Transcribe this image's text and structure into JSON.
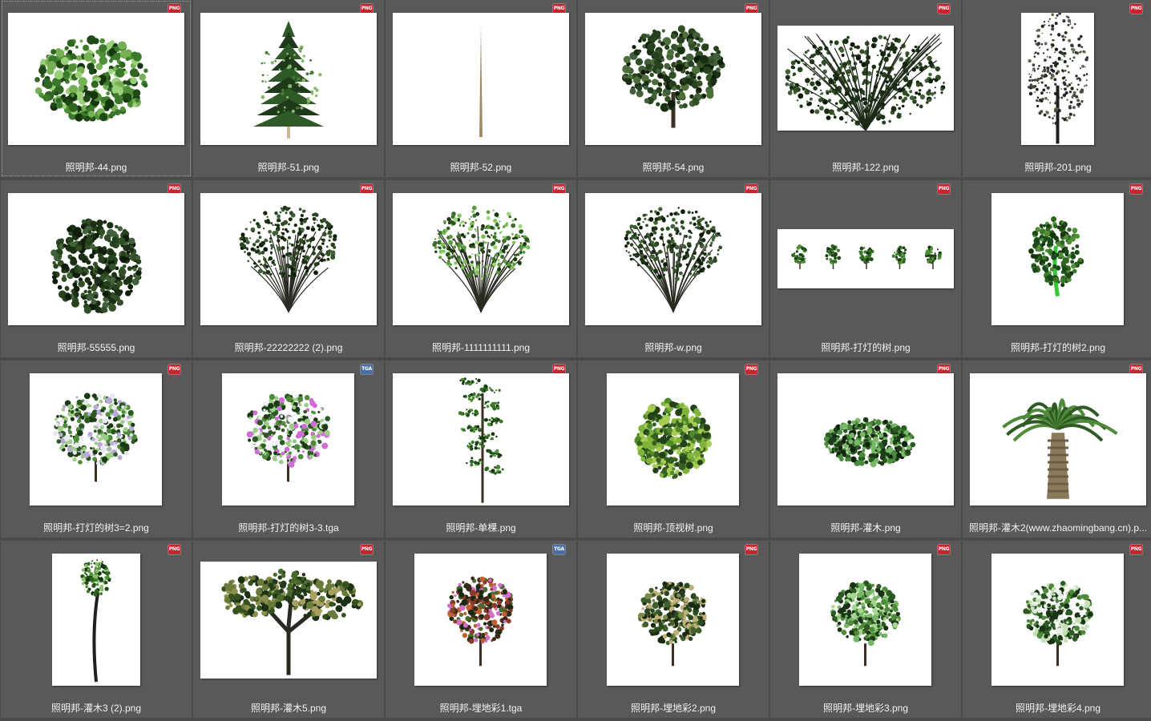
{
  "files": [
    {
      "name": "照明邦-44.png",
      "type": "PNG",
      "plant": "round-tree",
      "thumb": "landscape",
      "selected": true
    },
    {
      "name": "照明邦-51.png",
      "type": "PNG",
      "plant": "conifer",
      "thumb": "landscape"
    },
    {
      "name": "照明邦-52.png",
      "type": "PNG",
      "plant": "stick",
      "thumb": "landscape"
    },
    {
      "name": "照明邦-54.png",
      "type": "PNG",
      "plant": "dense-tree",
      "thumb": "landscape"
    },
    {
      "name": "照明邦-122.png",
      "type": "PNG",
      "plant": "wide-shrub",
      "thumb": "wide"
    },
    {
      "name": "照明邦-201.png",
      "type": "PNG",
      "plant": "sparse-tree",
      "thumb": "narrow-portrait"
    },
    {
      "name": "照明邦-55555.png",
      "type": "PNG",
      "plant": "bush",
      "thumb": "landscape"
    },
    {
      "name": "照明邦-22222222 (2).png",
      "type": "PNG",
      "plant": "branchy",
      "thumb": "landscape"
    },
    {
      "name": "照明邦-1111111111.png",
      "type": "PNG",
      "plant": "branchy-light",
      "thumb": "landscape"
    },
    {
      "name": "照明邦-w.png",
      "type": "PNG",
      "plant": "branchy",
      "thumb": "landscape"
    },
    {
      "name": "照明邦-打灯的树.png",
      "type": "PNG",
      "plant": "five-trees",
      "thumb": "strip"
    },
    {
      "name": "照明邦-打灯的树2.png",
      "type": "PNG",
      "plant": "green-trunk-tree",
      "thumb": "portrait"
    },
    {
      "name": "照明邦-打灯的树3=2.png",
      "type": "PNG",
      "plant": "lit-tree",
      "thumb": "portrait"
    },
    {
      "name": "照明邦-打灯的树3-3.tga",
      "type": "TGA",
      "plant": "lit-tree-purple",
      "thumb": "portrait"
    },
    {
      "name": "照明邦-单棵.png",
      "type": "PNG",
      "plant": "tall-pine",
      "thumb": "landscape"
    },
    {
      "name": "照明邦-顶视树.png",
      "type": "PNG",
      "plant": "top-view",
      "thumb": "portrait"
    },
    {
      "name": "照明邦-灌木.png",
      "type": "PNG",
      "plant": "mound",
      "thumb": "landscape"
    },
    {
      "name": "照明邦-灌木2(www.zhaomingbang.cn).p...",
      "type": "PNG",
      "plant": "palm",
      "thumb": "landscape"
    },
    {
      "name": "照明邦-灌木3 (2).png",
      "type": "PNG",
      "plant": "thin-tall",
      "thumb": "slim-portrait"
    },
    {
      "name": "照明邦-灌木5.png",
      "type": "PNG",
      "plant": "spreading",
      "thumb": "landscape-top"
    },
    {
      "name": "照明邦-埋地彩1.tga",
      "type": "TGA",
      "plant": "colored-tree",
      "thumb": "portrait"
    },
    {
      "name": "照明邦-埋地彩2.png",
      "type": "PNG",
      "plant": "lit-round",
      "thumb": "portrait"
    },
    {
      "name": "照明邦-埋地彩3.png",
      "type": "PNG",
      "plant": "lit-round-green",
      "thumb": "portrait"
    },
    {
      "name": "照明邦-埋地彩4.png",
      "type": "PNG",
      "plant": "lit-round-light",
      "thumb": "portrait"
    }
  ],
  "colors": {
    "png_badge": "#c9242b",
    "tga_badge": "#4a6fa5",
    "background": "#4b4b4b",
    "cell": "#595959"
  }
}
